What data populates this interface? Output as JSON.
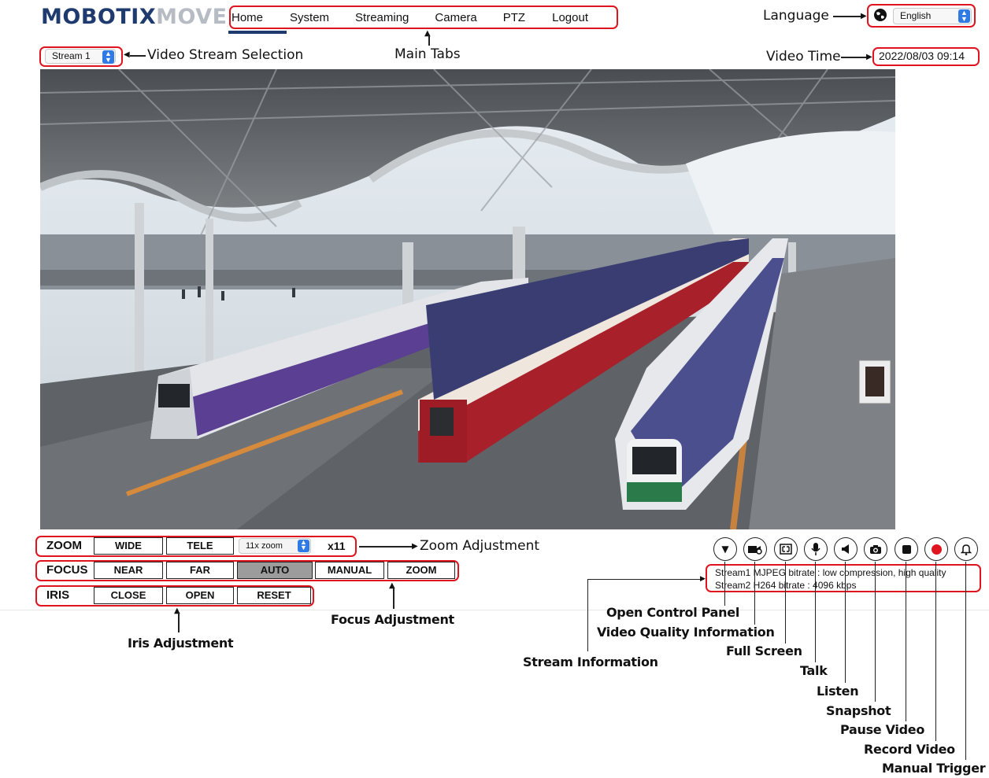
{
  "logo": {
    "part1": "MOBOTIX",
    "part2": "MOVE"
  },
  "tabs": [
    "Home",
    "System",
    "Streaming",
    "Camera",
    "PTZ",
    "Logout"
  ],
  "language": {
    "value": "English"
  },
  "stream_select": {
    "value": "Stream 1"
  },
  "video_time": "2022/08/03 09:14",
  "zoom": {
    "label": "ZOOM",
    "buttons": [
      "WIDE",
      "TELE"
    ],
    "select_value": "11x zoom",
    "level": "x11"
  },
  "focus": {
    "label": "FOCUS",
    "buttons": [
      "NEAR",
      "FAR",
      "AUTO",
      "MANUAL",
      "ZOOM"
    ],
    "active": "AUTO"
  },
  "iris": {
    "label": "IRIS",
    "buttons": [
      "CLOSE",
      "OPEN",
      "RESET"
    ]
  },
  "stream_info": [
    "Stream1 MJPEG bitrate : low compression, high quality",
    "Stream2 H264 bitrate : 4096 kbps"
  ],
  "icons": [
    "chevron-down-icon",
    "video-quality-icon",
    "fullscreen-icon",
    "microphone-icon",
    "speaker-icon",
    "camera-icon",
    "stop-icon",
    "record-icon",
    "bell-icon"
  ],
  "colors": {
    "annotation_red": "#e0141e",
    "brand_navy": "#1f3a6e",
    "active_button": "#9c9c9c",
    "select_blue": "#2f7ae5"
  },
  "annotations": {
    "language": "Language",
    "video_stream_selection": "Video Stream Selection",
    "main_tabs": "Main Tabs",
    "video_time": "Video Time",
    "zoom_adjustment": "Zoom Adjustment",
    "focus_adjustment": "Focus Adjustment",
    "iris_adjustment": "Iris Adjustment",
    "open_control_panel": "Open Control Panel",
    "video_quality_information": "Video Quality Information",
    "stream_information": "Stream Information",
    "full_screen": "Full Screen",
    "talk": "Talk",
    "listen": "Listen",
    "snapshot": "Snapshot",
    "pause_video": "Pause Video",
    "record_video": "Record Video",
    "manual_trigger": "Manual Trigger"
  }
}
